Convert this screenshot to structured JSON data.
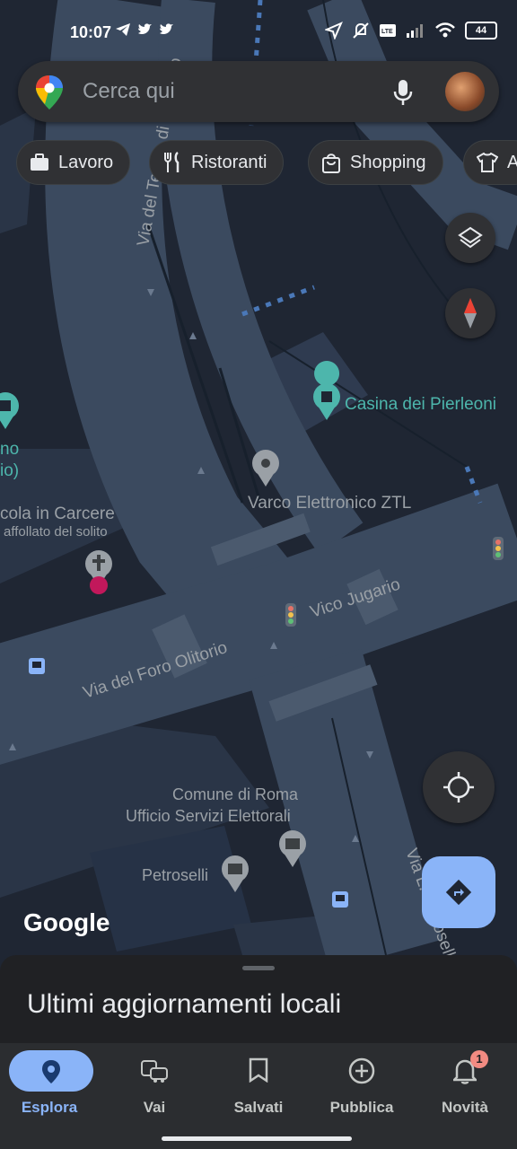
{
  "status_bar": {
    "time": "10:07",
    "battery": "44"
  },
  "search": {
    "placeholder": "Cerca qui"
  },
  "chips": [
    {
      "label": "Lavoro",
      "icon": "briefcase-icon"
    },
    {
      "label": "Ristoranti",
      "icon": "fork-knife-icon"
    },
    {
      "label": "Shopping",
      "icon": "shopping-bag-icon"
    },
    {
      "label": "A",
      "icon": "shirt-icon"
    }
  ],
  "map": {
    "streets": [
      "Via del Teatro di Marcello",
      "Vico Jugario",
      "Via del Foro Olitorio",
      "Via L. Petroselli"
    ],
    "places": {
      "casina": "Casina dei Pierleoni",
      "ztl": "Varco Elettronico ZTL",
      "nicola_1": "cola in Carcere",
      "nicola_2": "affollato del solito",
      "comune_1": "Comune di Roma",
      "comune_2": "Ufficio Servizi Elettorali",
      "petroselli": "Petroselli",
      "left_1": "no",
      "left_2": "io)"
    },
    "logo": "Google"
  },
  "colors": {
    "accent": "#8ab4f8",
    "teal_poi": "#4db6ac",
    "map_bg": "#1f2633",
    "road": "#3d4b5e"
  },
  "sheet": {
    "title": "Ultimi aggiornamenti locali"
  },
  "nav": [
    {
      "label": "Esplora",
      "icon": "location-pin-icon",
      "active": true
    },
    {
      "label": "Vai",
      "icon": "commute-icon"
    },
    {
      "label": "Salvati",
      "icon": "bookmark-icon"
    },
    {
      "label": "Pubblica",
      "icon": "add-circle-icon"
    },
    {
      "label": "Novità",
      "icon": "bell-icon",
      "badge": "1"
    }
  ]
}
